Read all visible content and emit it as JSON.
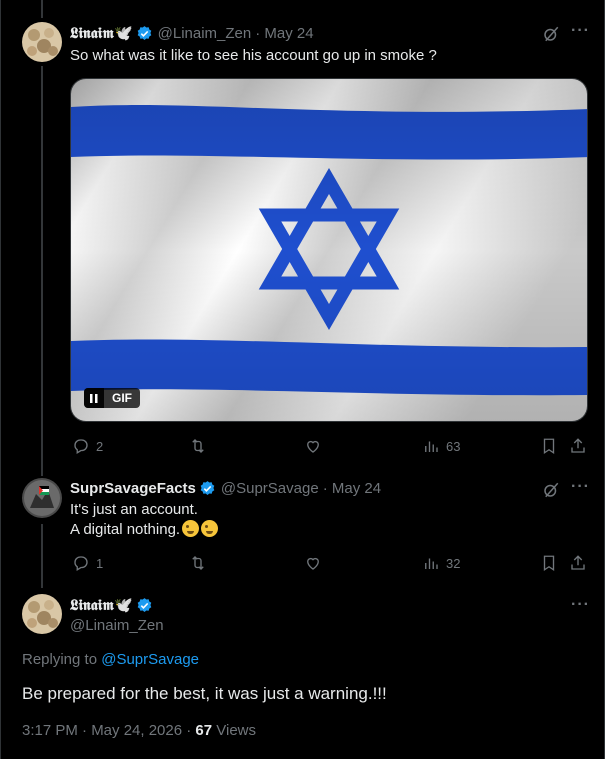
{
  "tweet1": {
    "name": "𝕷𝖎𝖓𝖆𝖎𝖒🕊️",
    "handle": "@Linaim_Zen",
    "date": "· May 24",
    "text": "So what was it like to see his account go up in smoke ?",
    "gif_label": "GIF",
    "replies": "2",
    "views": "63"
  },
  "tweet2": {
    "name": "SuprSavageFacts",
    "handle": "@SuprSavage",
    "date": "· May 24",
    "line1": "It's just an account.",
    "line2": "A digital nothing.",
    "replies": "1",
    "views": "32"
  },
  "main": {
    "name": "𝕷𝖎𝖓𝖆𝖎𝖒🕊️",
    "handle": "@Linaim_Zen",
    "replying_prefix": "Replying to ",
    "replying_to": "@SuprSavage",
    "text": "Be prepared for the best, it was just a warning.!!!",
    "time": "3:17 PM · May 24, 2026 · ",
    "views_count": "67",
    "views_label": " Views"
  },
  "colors": {
    "accent": "#1d9bf0",
    "muted": "#71767b",
    "flag_blue": "#1f4fcf"
  },
  "icons": [
    "reply-icon",
    "retweet-icon",
    "like-icon",
    "views-icon",
    "bookmark-icon",
    "share-icon",
    "grok-icon",
    "more-icon",
    "verified-icon"
  ]
}
